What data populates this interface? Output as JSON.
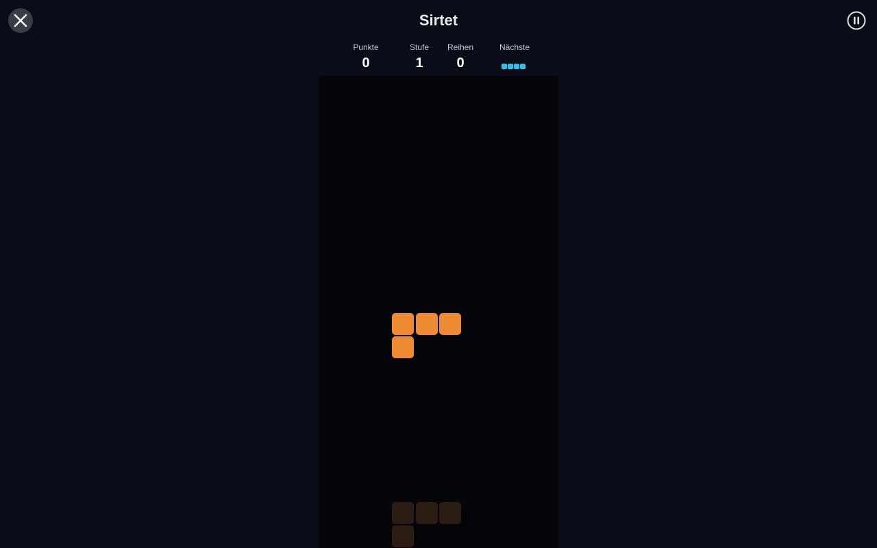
{
  "game": {
    "title": "Sirtet"
  },
  "stats": {
    "score_label": "Punkte",
    "score_value": "0",
    "level_label": "Stufe",
    "level_value": "1",
    "lines_label": "Reihen",
    "lines_value": "0",
    "next_label": "Nächste",
    "next_piece": "I"
  },
  "icons": {
    "close": "close-icon",
    "pause": "pause-icon"
  },
  "colors": {
    "background": "#0a0d18",
    "board": "#040509",
    "active_piece": "#ee8a31",
    "ghost_piece": "#2b1c14",
    "next_piece": "#2ec3e6"
  },
  "board": {
    "active_piece": "L",
    "ghost_piece": "L"
  }
}
